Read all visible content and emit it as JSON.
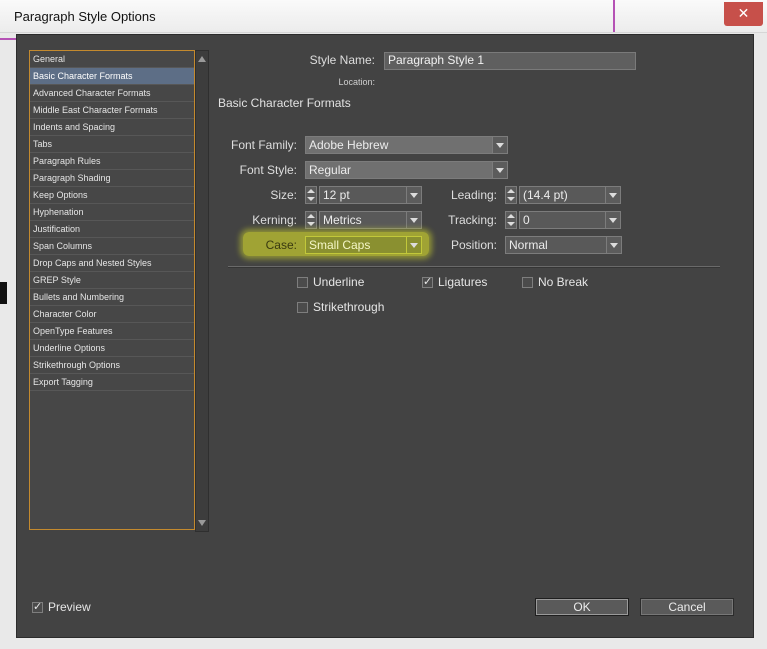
{
  "window": {
    "title": "Paragraph Style Options",
    "close_glyph": "✕"
  },
  "categories": [
    "General",
    "Basic Character Formats",
    "Advanced Character Formats",
    "Middle East Character Formats",
    "Indents and Spacing",
    "Tabs",
    "Paragraph Rules",
    "Paragraph Shading",
    "Keep Options",
    "Hyphenation",
    "Justification",
    "Span Columns",
    "Drop Caps and Nested Styles",
    "GREP Style",
    "Bullets and Numbering",
    "Character Color",
    "OpenType Features",
    "Underline Options",
    "Strikethrough Options",
    "Export Tagging"
  ],
  "selected_category": "Basic Character Formats",
  "style": {
    "name_label": "Style Name:",
    "name_value": "Paragraph Style 1",
    "location_label": "Location:"
  },
  "section_title": "Basic Character Formats",
  "fields": {
    "font_family": {
      "label": "Font Family:",
      "value": "Adobe Hebrew"
    },
    "font_style": {
      "label": "Font Style:",
      "value": "Regular"
    },
    "size": {
      "label": "Size:",
      "value": "12 pt"
    },
    "leading": {
      "label": "Leading:",
      "value": "(14.4 pt)"
    },
    "kerning": {
      "label": "Kerning:",
      "value": "Metrics"
    },
    "tracking": {
      "label": "Tracking:",
      "value": "0"
    },
    "case": {
      "label": "Case:",
      "value": "Small Caps"
    },
    "position": {
      "label": "Position:",
      "value": "Normal"
    }
  },
  "checkboxes": {
    "underline": {
      "label": "Underline",
      "checked": false
    },
    "ligatures": {
      "label": "Ligatures",
      "checked": true
    },
    "no_break": {
      "label": "No Break",
      "checked": false
    },
    "strikethrough": {
      "label": "Strikethrough",
      "checked": false
    },
    "preview": {
      "label": "Preview",
      "checked": true
    }
  },
  "buttons": {
    "ok": "OK",
    "cancel": "Cancel"
  },
  "check_glyph": "✓",
  "colors": {
    "highlight": "#ecf328",
    "selection": "#5d6e86",
    "list_border": "#c48a2e"
  }
}
